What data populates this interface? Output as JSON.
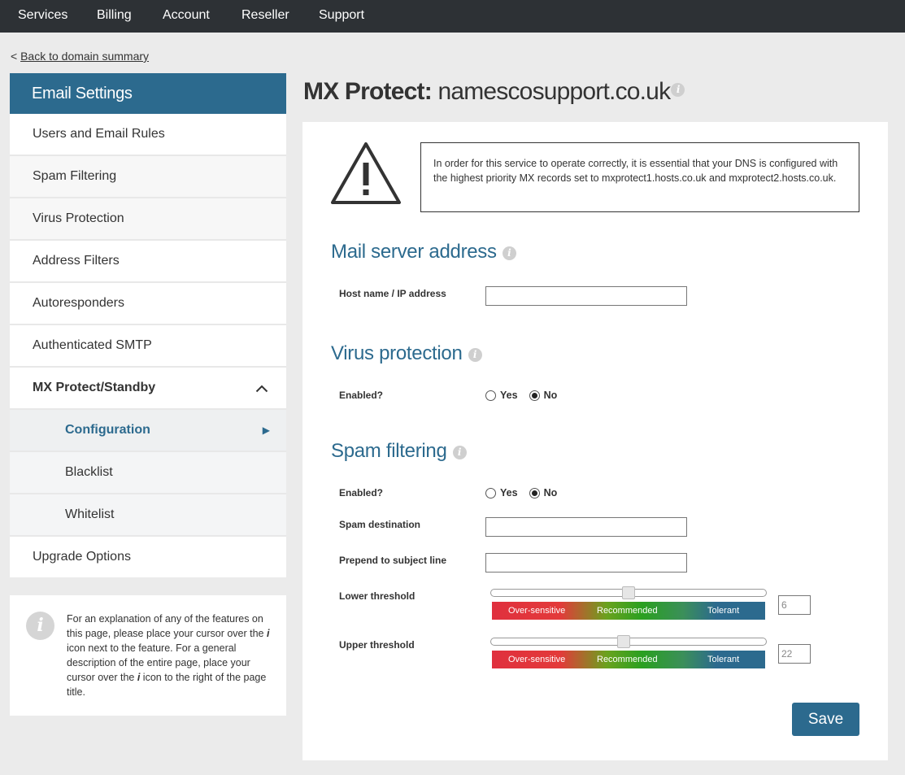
{
  "nav": {
    "items": [
      {
        "label": "Services"
      },
      {
        "label": "Billing"
      },
      {
        "label": "Account"
      },
      {
        "label": "Reseller"
      },
      {
        "label": "Support"
      }
    ]
  },
  "back_link": {
    "prefix": "<",
    "label": "Back to domain summary"
  },
  "sidebar": {
    "header": "Email Settings",
    "items": [
      {
        "label": "Users and Email Rules"
      },
      {
        "label": "Spam Filtering"
      },
      {
        "label": "Virus Protection"
      },
      {
        "label": "Address Filters"
      },
      {
        "label": "Autoresponders"
      },
      {
        "label": "Authenticated SMTP"
      },
      {
        "label": "MX Protect/Standby",
        "expanded": true
      },
      {
        "label": "Configuration",
        "active": true
      },
      {
        "label": "Blacklist"
      },
      {
        "label": "Whitelist"
      },
      {
        "label": "Upgrade Options"
      }
    ]
  },
  "infobox": {
    "icon": "info-icon",
    "text_parts": [
      "For an explanation of any of the features on this page, please place your cursor over the ",
      "i",
      " icon next to the feature. For a general description of the entire page, place your cursor over the ",
      "i",
      " icon to the right of the page title."
    ]
  },
  "page": {
    "title_bold": "MX Protect:",
    "title_domain": "namescosupport.co.uk",
    "info_glyph": "i"
  },
  "warning": {
    "icon": "warning-icon",
    "text": "In order for this service to operate correctly, it is essential that your DNS is configured with the highest priority MX records set to mxprotect1.hosts.co.uk and mxprotect2.hosts.co.uk."
  },
  "mail_server": {
    "heading": "Mail server address",
    "host_label": "Host name / IP address",
    "host_value": ""
  },
  "virus": {
    "heading": "Virus protection",
    "enabled_label": "Enabled?",
    "yes": "Yes",
    "no": "No",
    "selected": "No"
  },
  "spam": {
    "heading": "Spam filtering",
    "enabled_label": "Enabled?",
    "yes": "Yes",
    "no": "No",
    "selected": "No",
    "destination_label": "Spam destination",
    "destination_value": "",
    "prepend_label": "Prepend to subject line",
    "prepend_value": "",
    "lower_label": "Lower threshold",
    "lower_value": "6",
    "lower_position": 0.5,
    "upper_label": "Upper threshold",
    "upper_value": "22",
    "upper_position": 0.48,
    "scale_labels": [
      "Over-sensitive",
      "Recommended",
      "Tolerant"
    ],
    "scale_colors": [
      "#e0303e",
      "#2aa020",
      "#2c6a8e"
    ]
  },
  "save_label": "Save"
}
